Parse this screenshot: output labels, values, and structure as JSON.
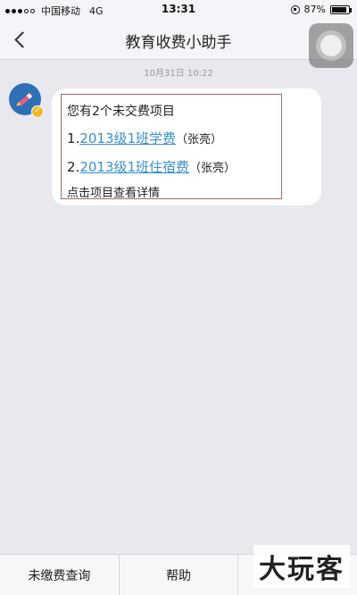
{
  "status_bar": {
    "carrier": "中国移动",
    "network": "4G",
    "time": "13:31",
    "battery": "87%",
    "battery_level": 0.87
  },
  "navbar": {
    "title": "教育收费小助手",
    "back_icon": "chevron-left-icon"
  },
  "chat": {
    "timestamp": "10月31日 10:22",
    "message": {
      "header": "您有2个未交费项目",
      "items": [
        {
          "prefix": "1.",
          "link": "2013级1班学费",
          "person": "（张亮）"
        },
        {
          "prefix": "2.",
          "link": "2013级1班住宿费",
          "person": "（张亮）"
        }
      ],
      "footer": "点击项目查看详情"
    }
  },
  "bottom_tabs": [
    {
      "label": "未缴费查询"
    },
    {
      "label": "帮助"
    },
    {
      "label": ""
    }
  ],
  "watermark": "大玩客",
  "colors": {
    "link": "#3a8fc9",
    "avatar": "#2e6fb6",
    "badge": "#f0b92a"
  }
}
